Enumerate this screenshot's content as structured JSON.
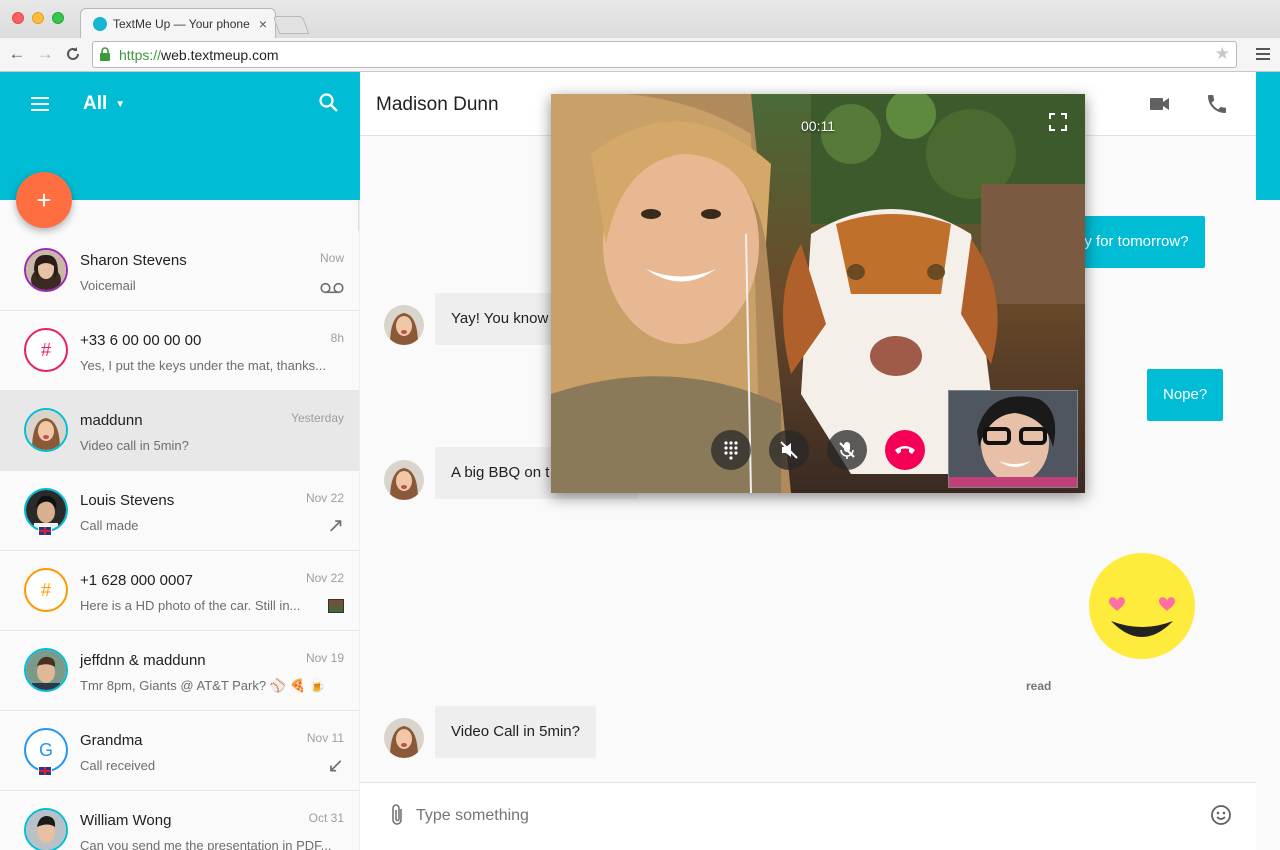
{
  "browser": {
    "tab_title": "TextMe Up — Your phone",
    "tab_close": "×",
    "url_scheme": "https://",
    "url_rest": "web.textmeup.com",
    "bookmark": "★"
  },
  "sidebar": {
    "filter_label": "All",
    "filter_caret": "▼",
    "fab_label": "+",
    "conversations": [
      {
        "name": "Sharon Stevens",
        "preview": "Voicemail",
        "time": "Now",
        "status_icon": "voicemail-icon"
      },
      {
        "name": "+33 6 00 00 00 00",
        "preview": "Yes, I put the keys under the mat, thanks...",
        "time": "8h",
        "avatar_text": "#",
        "avatar_color": "#e91e63"
      },
      {
        "name": "maddunn",
        "preview": "Video call in 5min?",
        "time": "Yesterday",
        "active": true
      },
      {
        "name": "Louis Stevens",
        "preview": "Call made",
        "time": "Nov 22",
        "status_icon": "outgoing-call-arrow-icon",
        "arrow": "↗"
      },
      {
        "name": "+1 628 000 0007",
        "preview": "Here is a HD photo of the car. Still in...",
        "time": "Nov 22",
        "avatar_text": "#",
        "avatar_color": "#ff9800",
        "status_icon": "photo-thumbnail"
      },
      {
        "name": "jeffdnn & maddunn",
        "preview": "Tmr 8pm, Giants @ AT&T Park? ⚾ 🍕 🍺",
        "time": "Nov 19"
      },
      {
        "name": "Grandma",
        "preview": "Call received",
        "time": "Nov 11",
        "avatar_text": "G",
        "avatar_color": "#2196f3",
        "status_icon": "incoming-call-arrow-icon",
        "arrow": "↙"
      },
      {
        "name": "William Wong",
        "preview": "Can you send me the presentation in PDF...",
        "time": "Oct 31"
      }
    ]
  },
  "chat": {
    "title": "Madison Dunn",
    "messages": [
      {
        "direction": "out",
        "text": "dy for tomorrow?"
      },
      {
        "direction": "in",
        "text": "Yay! You know"
      },
      {
        "direction": "out",
        "text": "Nope?"
      },
      {
        "direction": "in",
        "text": "A big BBQ on t"
      },
      {
        "direction": "in",
        "text": "Video Call in 5min?"
      }
    ],
    "read_label": "read",
    "composer_placeholder": "Type something"
  },
  "call": {
    "timer": "00:11"
  },
  "colors": {
    "accent": "#00bcd4",
    "fab": "#ff6e40",
    "hangup": "#f50057"
  }
}
